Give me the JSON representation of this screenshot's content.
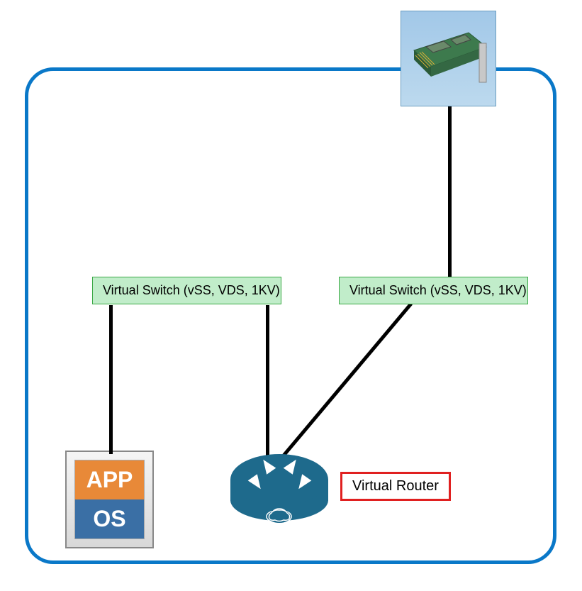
{
  "diagram": {
    "vswitch_left": "Virtual Switch (vSS, VDS, 1KV)",
    "vswitch_right": "Virtual Switch (vSS, VDS, 1KV)",
    "app_label": "APP",
    "os_label": "OS",
    "router_label": "Virtual Router"
  },
  "components": {
    "nic": {
      "name": "network-interface-card"
    },
    "vswitch_left": {
      "name": "virtual-switch-left"
    },
    "vswitch_right": {
      "name": "virtual-switch-right"
    },
    "vm": {
      "name": "virtual-machine-app-os"
    },
    "router": {
      "name": "virtual-router"
    }
  },
  "colors": {
    "border": "#0a78c8",
    "switch_bg": "#c1edca",
    "switch_border": "#3aa845",
    "router": "#1e6a8c",
    "app": "#e88938",
    "os": "#3a6fa5",
    "label_border": "#e02020"
  }
}
